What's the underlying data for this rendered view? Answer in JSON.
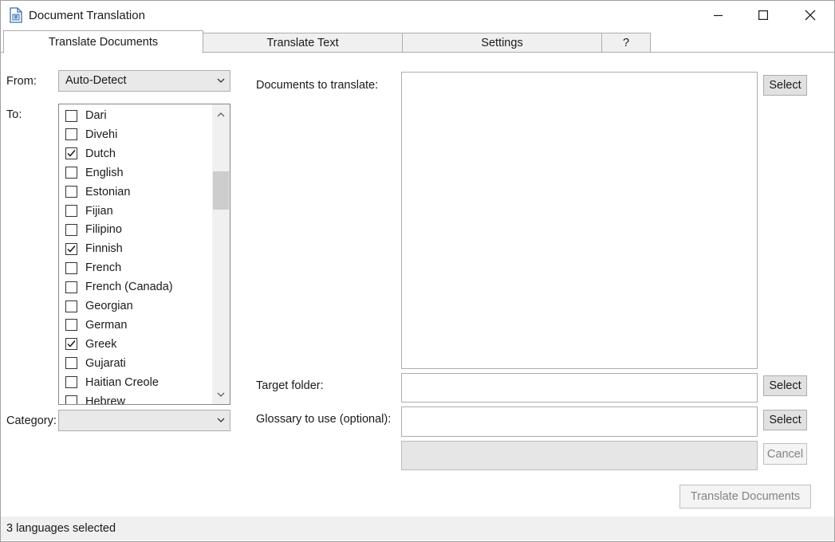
{
  "window": {
    "title": "Document Translation",
    "icon": "document-translate-icon"
  },
  "title_controls": {
    "minimize": "minimize-icon",
    "maximize": "maximize-icon",
    "close": "close-icon"
  },
  "tabs": [
    {
      "label": "Translate Documents",
      "active": true
    },
    {
      "label": "Translate Text",
      "active": false
    },
    {
      "label": "Settings",
      "active": false
    },
    {
      "label": "?",
      "active": false
    }
  ],
  "left": {
    "from_label": "From:",
    "from_value": "Auto-Detect",
    "to_label": "To:",
    "languages": [
      {
        "name": "Dari",
        "checked": false
      },
      {
        "name": "Divehi",
        "checked": false
      },
      {
        "name": "Dutch",
        "checked": true
      },
      {
        "name": "English",
        "checked": false
      },
      {
        "name": "Estonian",
        "checked": false
      },
      {
        "name": "Fijian",
        "checked": false
      },
      {
        "name": "Filipino",
        "checked": false
      },
      {
        "name": "Finnish",
        "checked": true
      },
      {
        "name": "French",
        "checked": false
      },
      {
        "name": "French (Canada)",
        "checked": false
      },
      {
        "name": "Georgian",
        "checked": false
      },
      {
        "name": "German",
        "checked": false
      },
      {
        "name": "Greek",
        "checked": true
      },
      {
        "name": "Gujarati",
        "checked": false
      },
      {
        "name": "Haitian Creole",
        "checked": false
      },
      {
        "name": "Hebrew",
        "checked": false
      }
    ],
    "category_label": "Category:",
    "category_value": ""
  },
  "right": {
    "documents_label": "Documents to translate:",
    "documents_select": "Select",
    "target_label": "Target folder:",
    "target_value": "",
    "target_select": "Select",
    "glossary_label": "Glossary to use (optional):",
    "glossary_value": "",
    "glossary_select": "Select",
    "cancel_label": "Cancel",
    "translate_label": "Translate Documents"
  },
  "status": {
    "text": "3 languages selected"
  }
}
